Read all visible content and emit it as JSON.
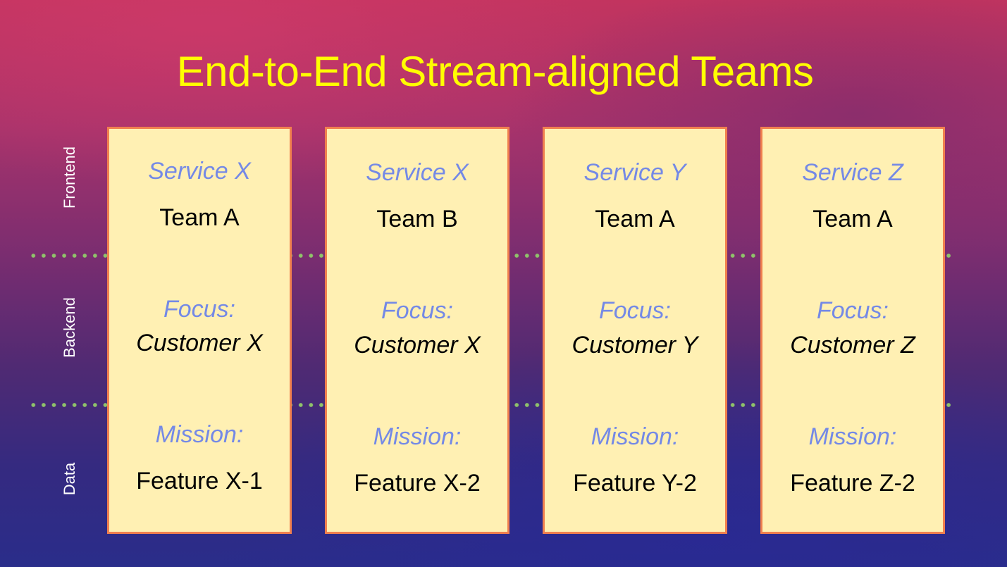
{
  "title": "End-to-End Stream-aligned Teams",
  "row_labels": [
    "Frontend",
    "Backend",
    "Data"
  ],
  "colors": {
    "title": "#ffff00",
    "card_fill": "#fff0b3",
    "card_border": "#f0804f",
    "label_blue": "#7489e6",
    "divider_dots": "#8fc26a"
  },
  "teams": [
    {
      "service": "Service X",
      "team": "Team A",
      "focus_label": "Focus:",
      "customer": "Customer X",
      "mission_label": "Mission:",
      "feature": "Feature X-1"
    },
    {
      "service": "Service X",
      "team": "Team B",
      "focus_label": "Focus:",
      "customer": "Customer X",
      "mission_label": "Mission:",
      "feature": "Feature X-2"
    },
    {
      "service": "Service Y",
      "team": "Team A",
      "focus_label": "Focus:",
      "customer": "Customer Y",
      "mission_label": "Mission:",
      "feature": "Feature Y-2"
    },
    {
      "service": "Service Z",
      "team": "Team A",
      "focus_label": "Focus:",
      "customer": "Customer Z",
      "mission_label": "Mission:",
      "feature": "Feature Z-2"
    }
  ]
}
